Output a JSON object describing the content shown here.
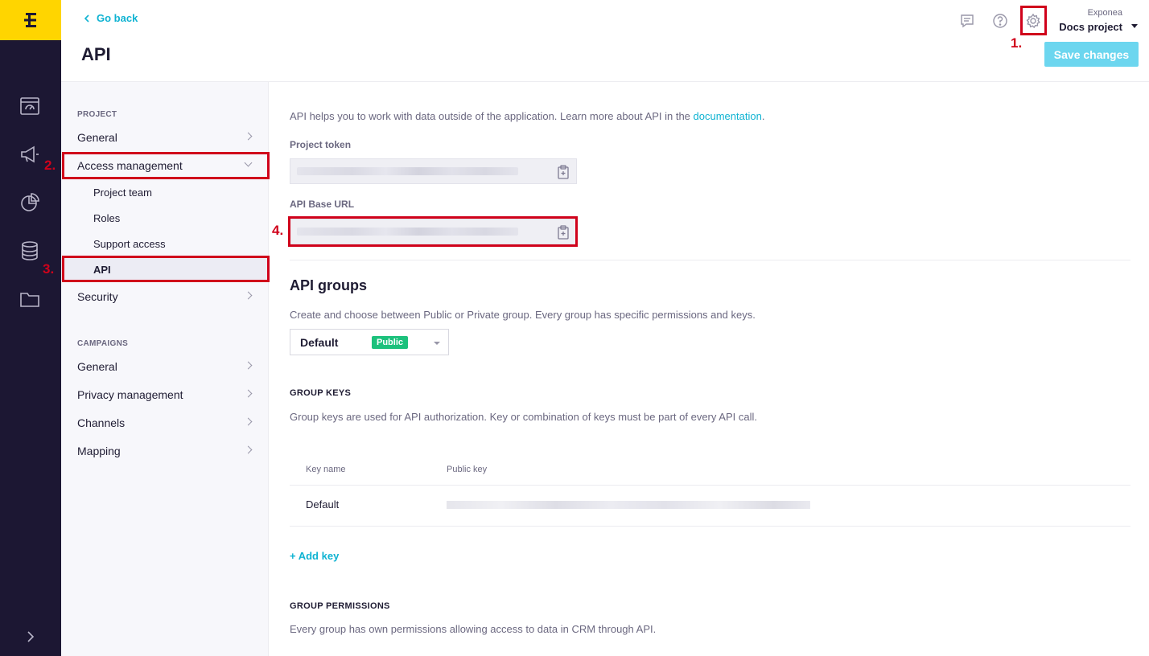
{
  "header": {
    "go_back": "Go back",
    "title": "API",
    "org": "Exponea",
    "project": "Docs project",
    "save_label": "Save changes"
  },
  "markers": {
    "m1": "1.",
    "m2": "2.",
    "m3": "3.",
    "m4": "4."
  },
  "sidebar": {
    "project_label": "PROJECT",
    "project_items": {
      "general": "General",
      "access": "Access management",
      "project_team": "Project team",
      "roles": "Roles",
      "support": "Support access",
      "api": "API",
      "security": "Security"
    },
    "campaigns_label": "CAMPAIGNS",
    "campaign_items": {
      "general": "General",
      "privacy": "Privacy management",
      "channels": "Channels",
      "mapping": "Mapping"
    }
  },
  "main": {
    "intro_text": "API helps you to work with data outside of the application. Learn more about API in the ",
    "intro_link": "documentation",
    "intro_end": ".",
    "project_token_label": "Project token",
    "api_base_url_label": "API Base URL",
    "groups_title": "API groups",
    "groups_desc": "Create and choose between Public or Private group. Every group has specific permissions and keys.",
    "group_select": {
      "name": "Default",
      "badge": "Public"
    },
    "group_keys_title": "GROUP KEYS",
    "group_keys_desc": "Group keys are used for API authorization. Key or combination of keys must be part of every API call.",
    "table": {
      "col_key_name": "Key name",
      "col_public_key": "Public key",
      "row_name": "Default"
    },
    "add_key": "+ Add key",
    "group_perms_title": "GROUP PERMISSIONS",
    "group_perms_desc": "Every group has own permissions allowing access to data in CRM through API."
  },
  "colors": {
    "accent": "#0fb3d2",
    "brand_yellow": "#ffd500",
    "rail_bg": "#1c1733",
    "public_badge": "#1cc17c",
    "marker_red": "#d0021b"
  },
  "icons": {
    "rail": [
      "dashboard-icon",
      "megaphone-icon",
      "pie-chart-icon",
      "database-icon",
      "folder-icon"
    ],
    "header": [
      "comment-icon",
      "help-icon",
      "gear-icon"
    ]
  }
}
